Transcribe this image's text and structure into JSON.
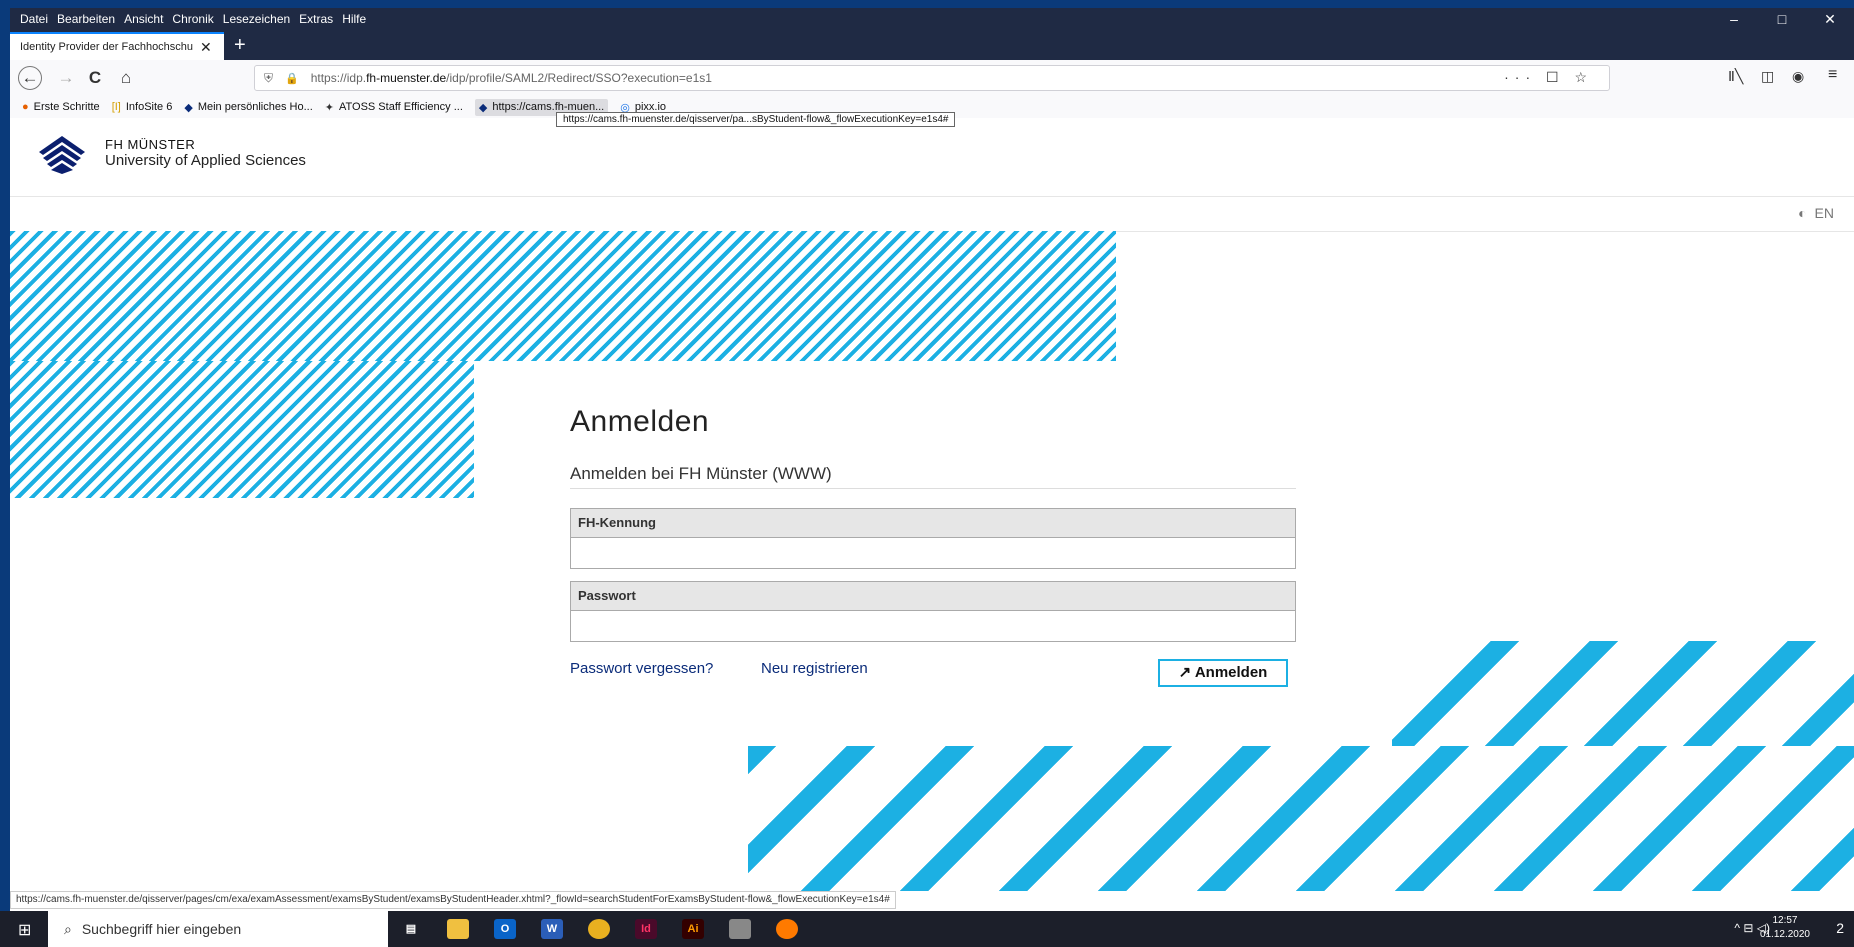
{
  "menu": [
    "Datei",
    "Bearbeiten",
    "Ansicht",
    "Chronik",
    "Lesezeichen",
    "Extras",
    "Hilfe"
  ],
  "window_controls": [
    "–",
    "□",
    "✕"
  ],
  "tab": {
    "title": "Identity Provider der Fachhochschu",
    "close": "✕",
    "new": "+"
  },
  "nav": {
    "back": "←",
    "forward": "→",
    "reload": "C",
    "home": "⌂",
    "url_prefix": "https://idp.",
    "url_domain": "fh-muenster.de",
    "url_rest": "/idp/profile/SAML2/Redirect/SSO?execution=e1s1",
    "url_actions": "··· ☐ ☆"
  },
  "bookmarks": [
    {
      "icon": "●",
      "label": "Erste Schritte"
    },
    {
      "icon": "[I]",
      "label": "InfoSite 6"
    },
    {
      "icon": "◆",
      "label": "Mein persönliches Ho..."
    },
    {
      "icon": "✦",
      "label": "ATOSS Staff Efficiency ..."
    },
    {
      "icon": "◆",
      "label": "https://cams.fh-muen..."
    },
    {
      "icon": "◎",
      "label": "pixx.io"
    }
  ],
  "tooltip": "https://cams.fh-muenster.de/qisserver/pa...sByStudent-flow&_flowExecutionKey=e1s4#",
  "brand": {
    "line1": "FH MÜNSTER",
    "line2": "University of Applied Sciences"
  },
  "lang": {
    "icon": "◐",
    "label": "EN"
  },
  "form": {
    "title": "Anmelden",
    "subtitle": "Anmelden bei FH Münster (WWW)",
    "user_label": "FH-Kennung",
    "user_value": "",
    "pass_label": "Passwort",
    "pass_value": "",
    "forgot": "Passwort vergessen?",
    "register": "Neu registrieren",
    "submit": "↗ Anmelden"
  },
  "status_url": "https://cams.fh-muenster.de/qisserver/pages/cm/exa/examAssessment/examsByStudent/examsByStudentHeader.xhtml?_flowId=searchStudentForExamsByStudent-flow&_flowExecutionKey=e1s4#",
  "taskbar": {
    "search_placeholder": "Suchbegriff hier eingeben",
    "time": "12:57",
    "date": "01.12.2020",
    "tray": "^ ⊟ ◁)",
    "notifications": "2"
  }
}
